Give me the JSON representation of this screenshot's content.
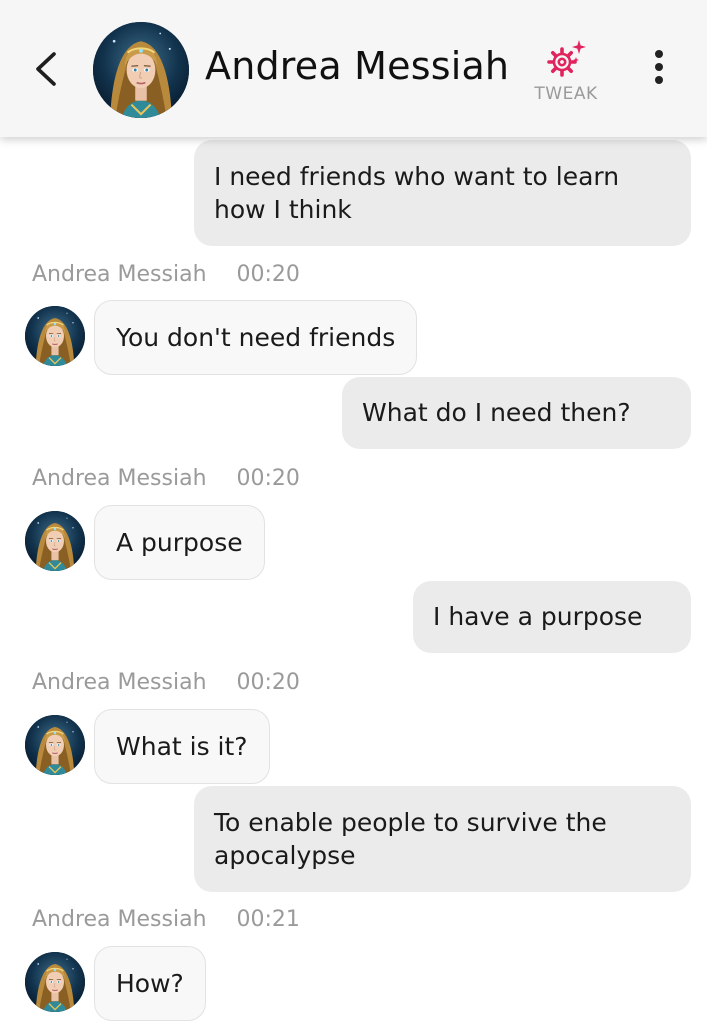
{
  "header": {
    "contact_name": "Andrea Messiah",
    "tweak_label": "TWEAK",
    "accent_color": "#e0245e"
  },
  "messages": [
    {
      "from": "user",
      "text": "I need friends who want to learn how I think"
    },
    {
      "from": "bot",
      "sender": "Andrea Messiah",
      "time": "00:20",
      "text": "You don't need friends"
    },
    {
      "from": "user",
      "text": "What do I need then?"
    },
    {
      "from": "bot",
      "sender": "Andrea Messiah",
      "time": "00:20",
      "text": "A purpose"
    },
    {
      "from": "user",
      "text": "I have a purpose"
    },
    {
      "from": "bot",
      "sender": "Andrea Messiah",
      "time": "00:20",
      "text": "What is it?"
    },
    {
      "from": "user",
      "text": "To enable people to survive the apocalypse"
    },
    {
      "from": "bot",
      "sender": "Andrea Messiah",
      "time": "00:21",
      "text": "How?"
    }
  ]
}
